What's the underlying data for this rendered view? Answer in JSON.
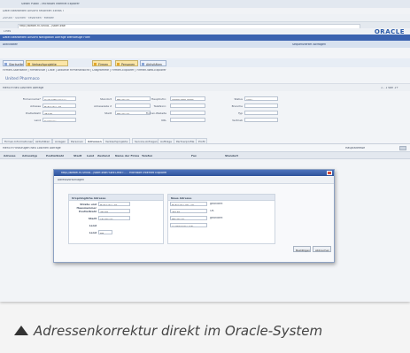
{
  "window": {
    "title": "Siebel Public - Microsoft Internet Explorer",
    "menu": "Datei   Bearbeiten   Ansicht   Favoriten   Extras   ?",
    "toolbar": "Zurück  ·  Suchen  ·  Favoriten  ·  Medien",
    "address": "http://siebel.fli-srv08.../start.swe",
    "links": "Links",
    "brand": "ORACLE"
  },
  "app": {
    "nav": "Datei   Bearbeiten   Ansicht   Navigation   Abfrage   Werkzeuge   Hilfe",
    "toolbar_left": "Aktivitäten",
    "toolbar_right": "Sequenzierter Abfragen",
    "screen_tabs": [
      "Startseite",
      "Verkaufsprojekte",
      "Firmen",
      "Personen",
      "Aktivitäten"
    ],
    "subtabs": "Firmen-Startseite  |  Firmenliste  |  Liste  |  Aktuelle Firmenansicht  |  Diagramme  |  Firmen-Explorer  |  Firmen-Web-Explorer",
    "account_title": "United Pharmaco",
    "page_tools": "Menü ▾   Neu   Löschen   Abfrage",
    "page_right": "1 - 1 von 1+"
  },
  "form": {
    "fields": [
      {
        "label": "Firmenname*",
        "value": "United Pharmaco"
      },
      {
        "label": "Adresse",
        "value": "Hofgarten 10"
      },
      {
        "label": "Postleitzahl",
        "value": "75175"
      },
      {
        "label": "Land",
        "value": "Germany"
      },
      {
        "label": "Standort",
        "value": "Pforzheim"
      },
      {
        "label": "Adresszeile 2",
        "value": ""
      },
      {
        "label": "Stadt",
        "value": "Pforzheim"
      },
      {
        "label": "Hauptrufnr.",
        "value": "(0000) 555-0000"
      },
      {
        "label": "Telefaxnr.",
        "value": ""
      },
      {
        "label": "Firmen-Website",
        "value": ""
      },
      {
        "label": "URL",
        "value": ""
      },
      {
        "label": "Status",
        "value": "Aktiv"
      },
      {
        "label": "Branche",
        "value": ""
      },
      {
        "label": "Typ",
        "value": ""
      },
      {
        "label": "Vertrieb",
        "value": ""
      }
    ]
  },
  "form_tabs": [
    "Firmen-Informationen",
    "Aktivitäten",
    "Anlagen",
    "Personen",
    "Adressen",
    "Verkaufsprojekte",
    "Service-Anfragen",
    "Aufträge",
    "Partnerprofile",
    "Profil"
  ],
  "list": {
    "left": "Menü ▾   Hinzufügen   Neu   Löschen   Abfrage",
    "right": "Hauptadresse",
    "columns": [
      "Adresse",
      "Adresstyp",
      "Postleitzahl",
      "Stadt",
      "Land",
      "Zustand",
      "Name der Firma",
      "Telefon",
      "Fax",
      "Standort"
    ]
  },
  "dialog": {
    "title": "http://siebel.fli-srv08.../start.swe?SWECmd=... - Microsoft Internet Explorer",
    "subtitle": "Adressvorschlägen",
    "left_head": "Ursprüngliche Adresse",
    "right_head": "Neue Adresse",
    "rows": [
      {
        "label": "Straße und Hausnummer",
        "orig": "Hofgarten 10",
        "new": "Hofgarten Str. 10",
        "flag": "geändert"
      },
      {
        "label": "Postleitzahl",
        "orig": "75175",
        "new": "75175",
        "flag": "OK"
      },
      {
        "label": "Stadt",
        "orig": "pforzheim",
        "new": "Pforzheim",
        "flag": "geändert"
      },
      {
        "label": "Land",
        "orig": "",
        "new": "Ausführliche Info",
        "flag": ""
      },
      {
        "label": "Land",
        "orig": "DE",
        "new": "",
        "flag": ""
      }
    ],
    "accept": "Bestätigen",
    "cancel": "Abbrechen"
  },
  "caption": "Adressenkorrektur direkt im Oracle-System"
}
